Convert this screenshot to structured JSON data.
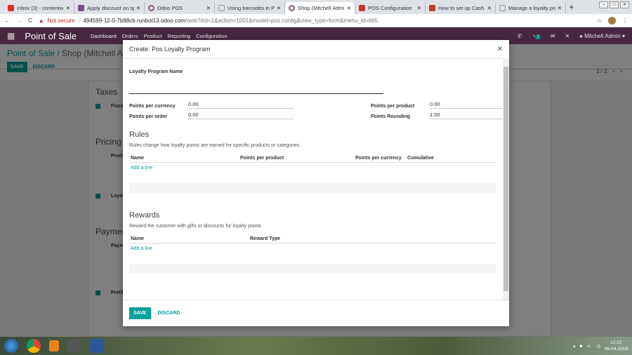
{
  "browser": {
    "tabs": [
      {
        "label": "Inbox (3) - contentw",
        "color": "#d93025"
      },
      {
        "label": "Apply discount on sp",
        "color": "#7b4a8f"
      },
      {
        "label": "Odoo POS",
        "color": "#875a7b"
      },
      {
        "label": "Using barcodes in Po",
        "color": "#999"
      },
      {
        "label": "Shop (Mitchell Admi",
        "color": "#875a7b",
        "active": true
      },
      {
        "label": "POS Configuration",
        "color": "#c0392b"
      },
      {
        "label": "How to set up Cash C",
        "color": "#c0392b"
      },
      {
        "label": "Manage a loyalty pro",
        "color": "#999"
      }
    ],
    "security": "Not secure",
    "url_host": "494599-12-0-7b98cb.runbot13.odoo.com",
    "url_path": "/web?#id=1&action=1001&model=pos.config&view_type=form&menu_id=665"
  },
  "navbar": {
    "brand": "Point of Sale",
    "menu": [
      "Dashboard",
      "Orders",
      "Product",
      "Reporting",
      "Configuration"
    ],
    "badge": "7",
    "user": "Mitchell Admin"
  },
  "control": {
    "breadcrumb_root": "Point of Sale",
    "breadcrumb_current": "Shop (Mitchell Admin)",
    "save": "SAVE",
    "discard": "DISCARD",
    "pager": "1 / 2"
  },
  "background": {
    "headings": [
      "Taxes",
      "Pricing",
      "Payments"
    ],
    "items": [
      "Fiscal Position",
      "Product Prices",
      "Loyalty Program",
      "Payment Methods",
      "Prefill Cash Payment"
    ]
  },
  "modal": {
    "title": "Create: Pos Loyalty Program",
    "name_label": "Loyalty Program Name",
    "name_value": "",
    "fields": [
      {
        "label": "Points per currency",
        "value": "0.00"
      },
      {
        "label": "Points per product",
        "value": "0.00"
      },
      {
        "label": "Points per order",
        "value": "0.00"
      },
      {
        "label": "Points Rounding",
        "value": "1.00"
      }
    ],
    "rules": {
      "title": "Rules",
      "desc": "Rules change how loyalty points are earned for specific products or categories",
      "columns": [
        "Name",
        "Points per product",
        "Points per currency",
        "Cumulative"
      ],
      "add": "Add a line"
    },
    "rewards": {
      "title": "Rewards",
      "desc": "Reward the customer with gifts or discounts for loyalty points",
      "columns": [
        "Name",
        "Reward Type"
      ],
      "add": "Add a line"
    },
    "save": "SAVE",
    "discard": "DISCARD"
  },
  "taskbar": {
    "time": "12:22",
    "date": "06-04-2019"
  },
  "accent": "#00a09d",
  "navbar_color": "#47273f"
}
